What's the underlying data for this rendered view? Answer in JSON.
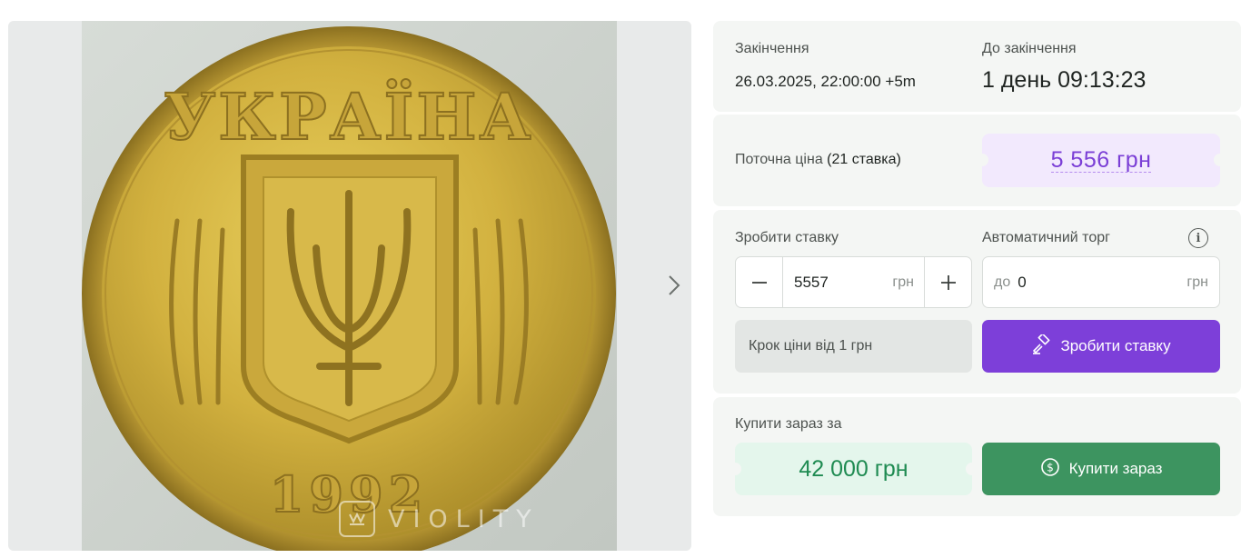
{
  "gallery": {
    "watermark": "VIOLITY",
    "image_alt": "Coin photo",
    "coin_text_top": "УКРАЇНА",
    "coin_year": "1992"
  },
  "auction": {
    "end_label": "Закінчення",
    "end_value": "26.03.2025, 22:00:00 +5m",
    "remaining_label": "До закінчення",
    "remaining_value": "1 день 09:13:23",
    "current_price_label": "Поточна ціна",
    "bids_count": "(21 ставка)",
    "current_price": "5 556 грн"
  },
  "bid": {
    "label": "Зробити ставку",
    "amount": "5557",
    "unit": "грн",
    "auto_label": "Автоматичний торг",
    "auto_prefix": "до",
    "auto_amount": "0",
    "auto_unit": "грн",
    "step_note": "Крок ціни від 1 грн",
    "button": "Зробити ставку"
  },
  "buy_now": {
    "label": "Купити зараз за",
    "price": "42 000 грн",
    "button": "Купити зараз"
  },
  "colors": {
    "accent_purple": "#7d3fd9",
    "price_purple": "#7b3fd6",
    "accent_green": "#3d9460",
    "price_green": "#1f8b52"
  },
  "icons": [
    "next-arrow-icon",
    "minus-icon",
    "plus-icon",
    "info-icon",
    "gavel-icon",
    "dollar-coin-icon",
    "violity-logo-icon"
  ]
}
